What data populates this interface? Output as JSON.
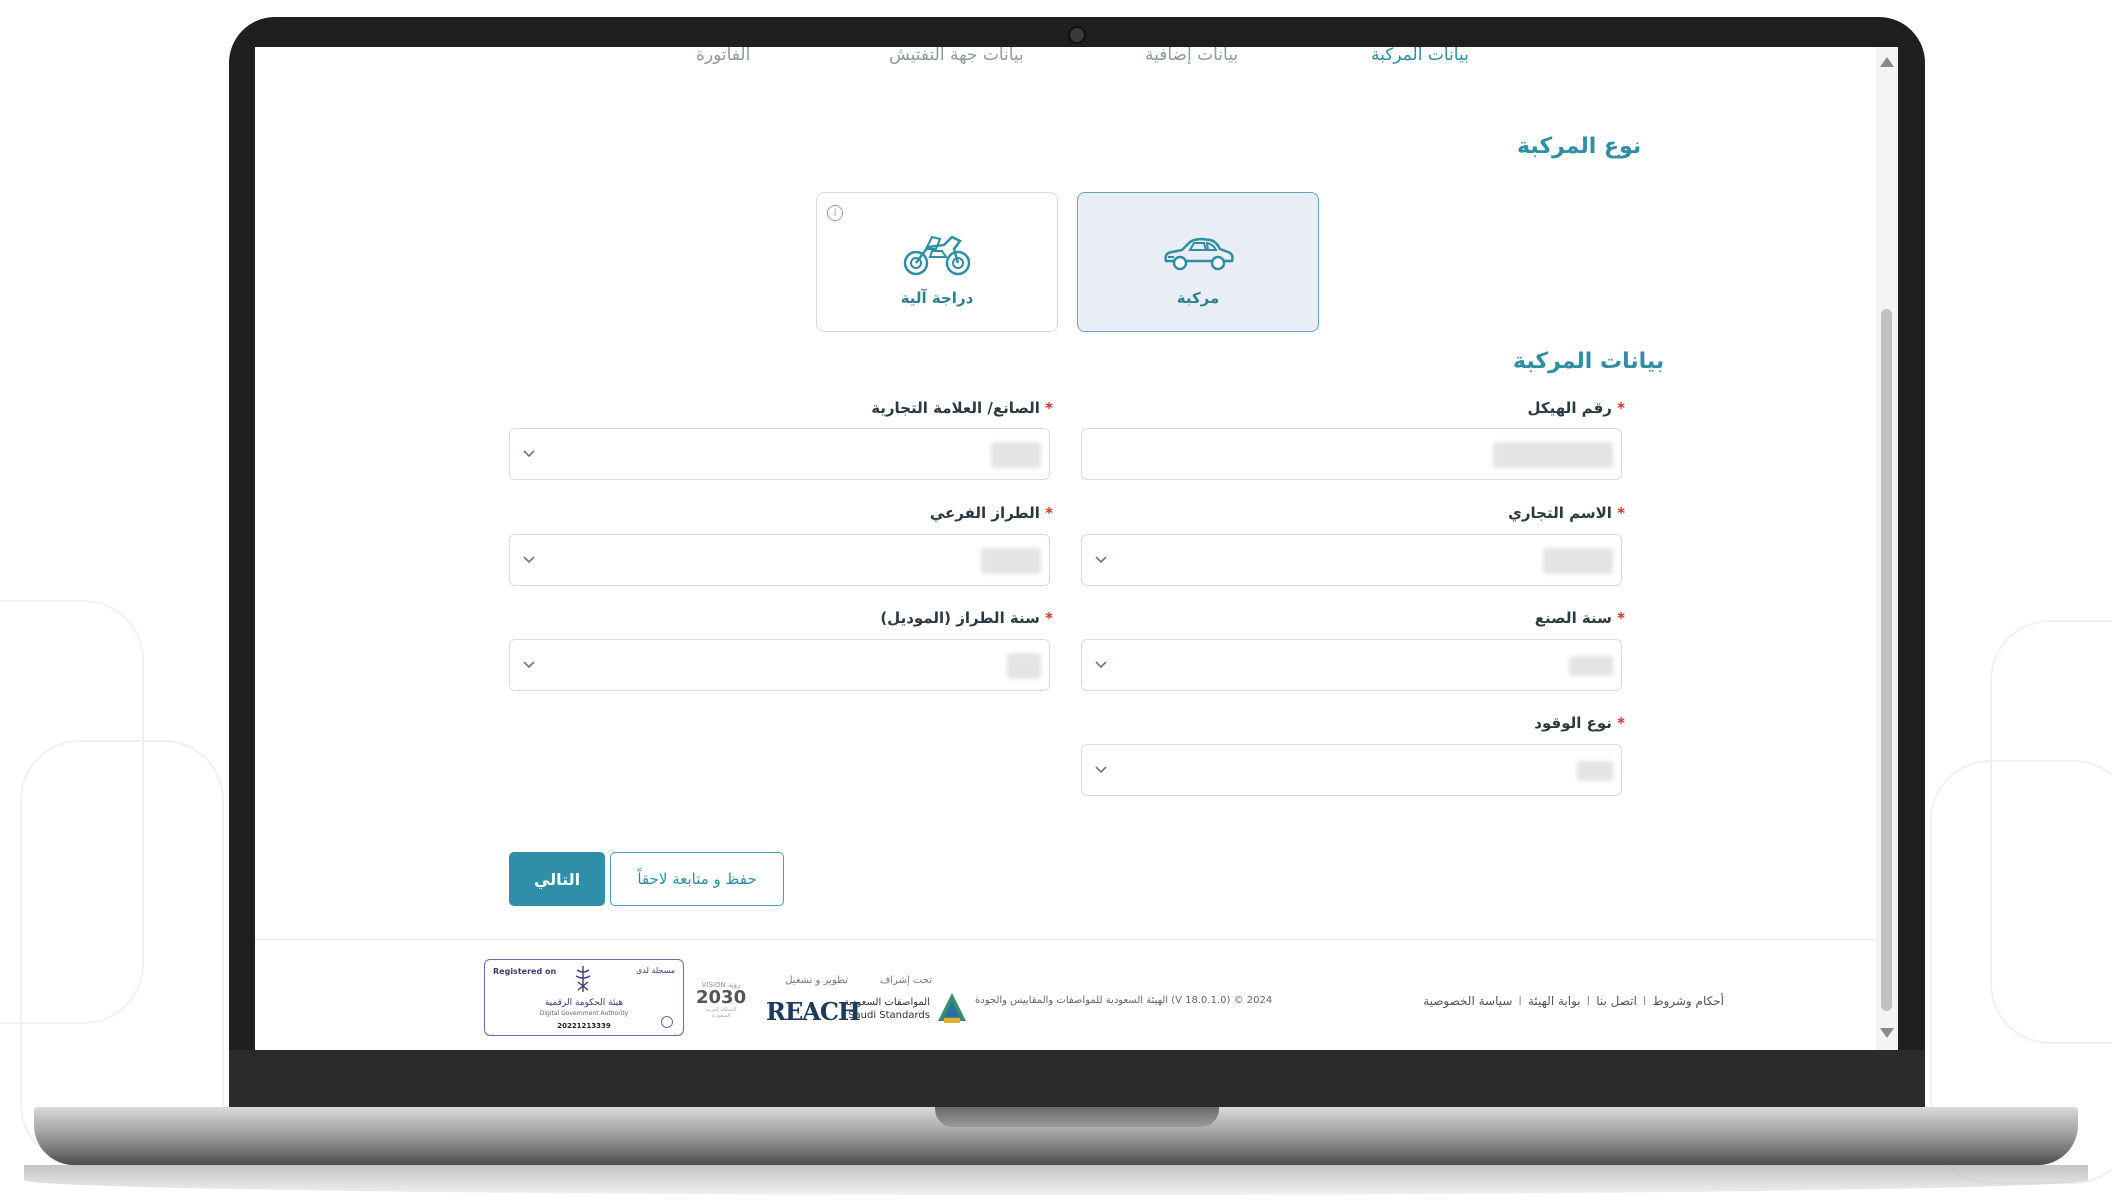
{
  "steps": [
    {
      "label": "بيانات المركبة",
      "active": true
    },
    {
      "label": "بيانات إضافية",
      "active": false
    },
    {
      "label": "بيانات جهة التفتيش",
      "active": false
    },
    {
      "label": "الفاتورة",
      "active": false
    }
  ],
  "vehicle_type": {
    "title": "نوع المركبة",
    "options": [
      {
        "label": "مركبة",
        "icon": "car-icon",
        "selected": true
      },
      {
        "label": "دراجة آلية",
        "icon": "motorcycle-icon",
        "selected": false
      }
    ]
  },
  "vehicle_data": {
    "title": "بيانات المركبة",
    "fields": {
      "chassis": {
        "label": "رقم الهيكل",
        "required": "*"
      },
      "manufacturer": {
        "label": "الصانع/ العلامة التجارية",
        "required": "*"
      },
      "trade_name": {
        "label": "الاسم التجاري",
        "required": "*"
      },
      "sub_model": {
        "label": "الطراز الفرعي",
        "required": "*"
      },
      "manufacture_year": {
        "label": "سنة الصنع",
        "required": "*"
      },
      "model_year": {
        "label": "سنة الطراز (الموديل)",
        "required": "*"
      },
      "fuel_type": {
        "label": "نوع الوقود",
        "required": "*"
      }
    }
  },
  "actions": {
    "next": "التالي",
    "save_later": "حفظ و متابعة لاحقاً"
  },
  "footer": {
    "links": [
      "أحكام وشروط",
      "اتصل بنا",
      "بوابة الهيئة",
      "سياسة الخصوصية"
    ],
    "separator": "I",
    "copyright": "الهيئة السعودية للمواصفات والمقاييس والجودة (V 18.0.1.0) © 2024",
    "saso_supervision": "تحت إشراف",
    "saso_name_ar": "المواصفات السعودية",
    "saso_name_en": "Saudi Standards",
    "developer_label": "تطوير و تشغيل",
    "developer_logo": "REACH",
    "vision_top": "VISION رؤية",
    "vision_year": "2030",
    "vision_bottom": "المملكة العربية السعودية",
    "dga_registered": "Registered on",
    "dga_registered_ar": "مسجلة لدى",
    "dga_name_ar": "هيئة الحكومة الرقمية",
    "dga_name_en": "Digital Government Authority",
    "dga_number": "20221213339"
  },
  "colors": {
    "accent": "#2e8ea4",
    "required": "#d8342b",
    "selected_card_bg": "#e9eef6"
  }
}
